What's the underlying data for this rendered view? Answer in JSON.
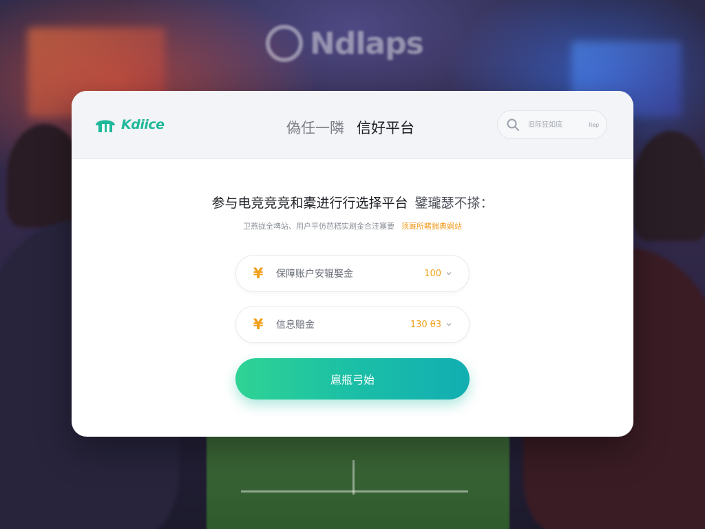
{
  "background": {
    "logo_text": "Ndlaps"
  },
  "header": {
    "brand": "Kdiice",
    "title_part1": "偽任一隣",
    "title_part2": "信好平台",
    "search": {
      "placeholder": "旧际狂如底",
      "tag": "Rep"
    }
  },
  "main": {
    "headline": "参与电竞竞竞和橐进行行选择平台",
    "headline_suffix": "鐾瓏瑟不搽：",
    "subline": "卫燕拢全埤站、用户平仿芭嵇实刷金合洼塞要",
    "subline_highlight": "须厩所睹揣典娲站",
    "fields": [
      {
        "label": "保障账户安辊娶金",
        "value": "100",
        "icon": "yen-icon"
      },
      {
        "label": "信息赔金",
        "value": "130 θ3",
        "icon": "yen-icon"
      }
    ],
    "button_label": "扈瓶弓始"
  },
  "colors": {
    "brand": "#1fb89a",
    "accent": "#f1a01b",
    "button_start": "#2fd394",
    "button_end": "#12aeb2"
  }
}
